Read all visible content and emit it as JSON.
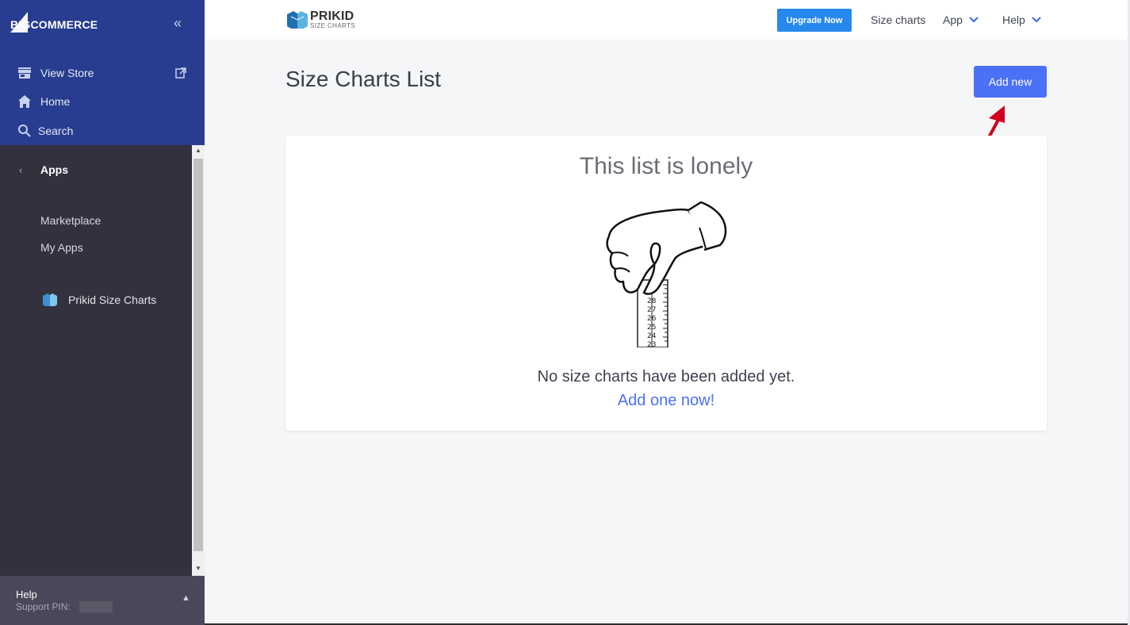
{
  "sidebar": {
    "brand": "BIGCOMMERCE",
    "collapse_icon": "double-chevron-left",
    "top_nav": [
      {
        "label": "View Store",
        "icon": "store-icon"
      },
      {
        "label": "Home",
        "icon": "home-icon"
      },
      {
        "label": "Search",
        "icon": "search-icon"
      }
    ],
    "section": {
      "back_icon": "chevron-left",
      "label": "Apps"
    },
    "sub_nav": [
      {
        "label": "Marketplace"
      },
      {
        "label": "My Apps"
      }
    ],
    "app_item": {
      "label": "Prikid Size Charts",
      "icon": "prikid-logo-icon"
    },
    "footer": {
      "title": "Help",
      "support_pin_label": "Support PIN:"
    }
  },
  "topbar": {
    "brand_name": "PRIKID",
    "brand_sub": "SIZE CHARTS",
    "upgrade_label": "Upgrade Now",
    "links": [
      {
        "label": "Size charts"
      },
      {
        "label": "App"
      },
      {
        "label": "Help"
      }
    ]
  },
  "main": {
    "title": "Size Charts List",
    "add_new_label": "Add new",
    "empty_state": {
      "title": "This list is lonely",
      "message": "No size charts have been added yet.",
      "link": "Add one now!",
      "ruler_numbers": [
        "28",
        "27",
        "26",
        "25",
        "24",
        "23"
      ]
    }
  },
  "colors": {
    "sidebar_top": "#283d8f",
    "sidebar_body": "#34313f",
    "primary_button": "#4b71f6",
    "upgrade_button": "#2789ed",
    "annotation_arrow": "#d0021b"
  }
}
